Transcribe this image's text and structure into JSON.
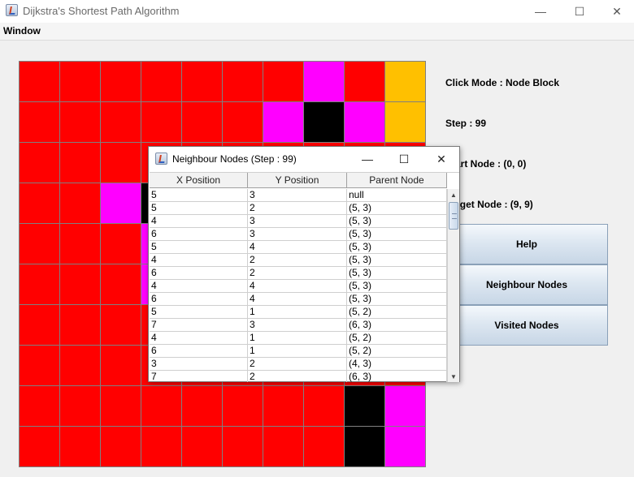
{
  "window": {
    "title": "Dijkstra's Shortest Path Algorithm",
    "minimize": "—",
    "maximize": "☐",
    "close": "✕"
  },
  "menu": {
    "items": [
      "Window"
    ]
  },
  "grid": {
    "colors": {
      "R": "#ff0000",
      "M": "#ff00ff",
      "K": "#000000",
      "Y": "#ffc000"
    },
    "rows": [
      [
        "R",
        "R",
        "R",
        "R",
        "R",
        "R",
        "R",
        "M",
        "R",
        "Y"
      ],
      [
        "R",
        "R",
        "R",
        "R",
        "R",
        "R",
        "M",
        "K",
        "M",
        "Y"
      ],
      [
        "R",
        "R",
        "R",
        "R",
        "R",
        "R",
        "R",
        "R",
        "R",
        "R"
      ],
      [
        "R",
        "R",
        "M",
        "K",
        "R",
        "R",
        "R",
        "R",
        "R",
        "R"
      ],
      [
        "R",
        "R",
        "R",
        "M",
        "R",
        "R",
        "R",
        "R",
        "R",
        "R"
      ],
      [
        "R",
        "R",
        "R",
        "M",
        "R",
        "R",
        "R",
        "R",
        "R",
        "R"
      ],
      [
        "R",
        "R",
        "R",
        "R",
        "R",
        "R",
        "R",
        "R",
        "R",
        "R"
      ],
      [
        "R",
        "R",
        "R",
        "R",
        "R",
        "R",
        "R",
        "R",
        "R",
        "R"
      ],
      [
        "R",
        "R",
        "R",
        "R",
        "R",
        "R",
        "R",
        "R",
        "K",
        "M"
      ],
      [
        "R",
        "R",
        "R",
        "R",
        "R",
        "R",
        "R",
        "R",
        "K",
        "M"
      ]
    ]
  },
  "side": {
    "click_mode": "Click Mode : Node Block",
    "step": "Step : 99",
    "start_node": "Start Node : (0, 0)",
    "target_node": "Target Node : (9, 9)",
    "buttons": [
      "Help",
      "Neighbour Nodes",
      "Visited Nodes"
    ]
  },
  "dialog": {
    "title": "Neighbour Nodes (Step : 99)",
    "columns": [
      "X Position",
      "Y Position",
      "Parent Node"
    ],
    "rows": [
      [
        "5",
        "3",
        "null"
      ],
      [
        "5",
        "2",
        "(5, 3)"
      ],
      [
        "4",
        "3",
        "(5, 3)"
      ],
      [
        "6",
        "3",
        "(5, 3)"
      ],
      [
        "5",
        "4",
        "(5, 3)"
      ],
      [
        "4",
        "2",
        "(5, 3)"
      ],
      [
        "6",
        "2",
        "(5, 3)"
      ],
      [
        "4",
        "4",
        "(5, 3)"
      ],
      [
        "6",
        "4",
        "(5, 3)"
      ],
      [
        "5",
        "1",
        "(5, 2)"
      ],
      [
        "7",
        "3",
        "(6, 3)"
      ],
      [
        "4",
        "1",
        "(5, 2)"
      ],
      [
        "6",
        "1",
        "(5, 2)"
      ],
      [
        "3",
        "2",
        "(4, 3)"
      ],
      [
        "7",
        "2",
        "(6, 3)"
      ]
    ]
  }
}
